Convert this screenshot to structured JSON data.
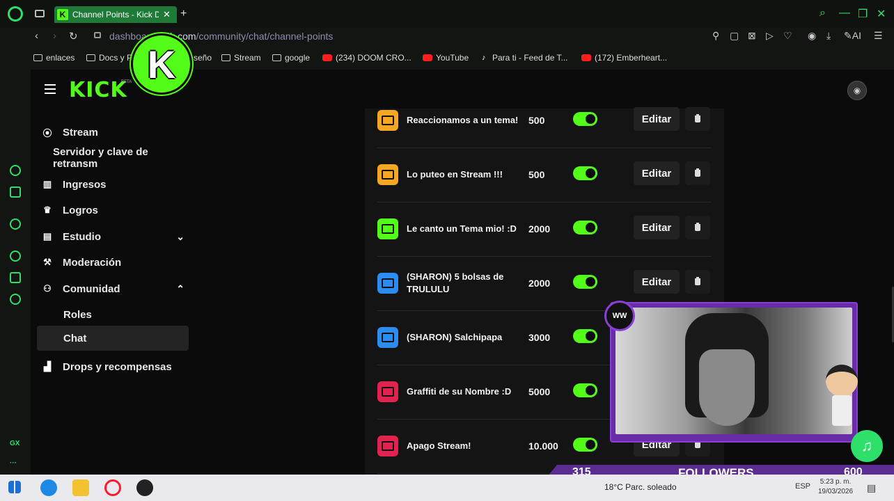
{
  "browser": {
    "tab_title": "Channel Points - Kick Dash",
    "tab_close": "✕",
    "new_tab": "+",
    "url_prefix": "dashboard.",
    "url_domain": "kick.com",
    "url_path": "/community/chat/channel-points",
    "bookmarks": [
      {
        "label": "enlaces",
        "icon": "folder-icon"
      },
      {
        "label": "Docs y P",
        "icon": "folder-icon"
      },
      {
        "label": "seño",
        "icon": "folder-icon"
      },
      {
        "label": "Stream",
        "icon": "folder-icon"
      },
      {
        "label": "google",
        "icon": "folder-icon"
      },
      {
        "label": "(234) DOOM CRO...",
        "icon": "youtube-icon"
      },
      {
        "label": "YouTube",
        "icon": "youtube-icon"
      },
      {
        "label": "Para ti - Feed de T...",
        "icon": "tiktok-icon"
      },
      {
        "label": "(172) Emberheart...",
        "icon": "youtube-icon"
      }
    ],
    "ai_label": "AI",
    "gx_label": "GX"
  },
  "overlay_logo": "K",
  "app": {
    "logo": "KICK",
    "beta": "BETA"
  },
  "sidebar": {
    "items": [
      {
        "label": "Stream",
        "icon": "broadcast-icon"
      },
      {
        "label": "Servidor y clave de retransm"
      },
      {
        "label": "Ingresos",
        "icon": "chart-icon"
      },
      {
        "label": "Logros",
        "icon": "trophy-icon"
      },
      {
        "label": "Estudio",
        "icon": "studio-icon",
        "chevron": "⌄"
      },
      {
        "label": "Moderación",
        "icon": "wrench-icon"
      },
      {
        "label": "Comunidad",
        "icon": "community-icon",
        "chevron": "⌃"
      },
      {
        "label": "Roles"
      },
      {
        "label": "Chat",
        "active": true
      },
      {
        "label": "Drops y recompensas",
        "icon": "drops-icon"
      }
    ]
  },
  "rewards": {
    "edit_label": "Editar",
    "rows": [
      {
        "title": "Reaccionamos a un tema!",
        "cost": "500",
        "color": "#f5a623",
        "enabled": true
      },
      {
        "title": "Lo puteo en Stream !!!",
        "cost": "500",
        "color": "#f5a623",
        "enabled": true
      },
      {
        "title": "Le canto un Tema mio! :D",
        "cost": "2000",
        "color": "#53fc18",
        "enabled": true
      },
      {
        "title": "(SHARON) 5 bolsas de TRULULU",
        "cost": "2000",
        "color": "#2d8cf0",
        "enabled": true
      },
      {
        "title": "(SHARON) Salchipapa",
        "cost": "3000",
        "color": "#2d8cf0",
        "enabled": true
      },
      {
        "title": "Graffiti de su Nombre :D",
        "cost": "5000",
        "color": "#e0244f",
        "enabled": true
      },
      {
        "title": "Apago Stream!",
        "cost": "10.000",
        "color": "#e0244f",
        "enabled": true
      }
    ]
  },
  "overlay": {
    "badge": "WW",
    "followers_count": "315",
    "followers_label": "FOLLOWERS",
    "followers_goal": "600",
    "progress_fraction": 0.525
  },
  "taskbar": {
    "weather": "18°C  Parc. soleado",
    "lang": "ESP",
    "time": "5:23 p. m.",
    "date": "19/03/2026"
  },
  "colors": {
    "kick_green": "#53fc18",
    "opera_green": "#2ee06a",
    "overlay_purple": "#5c2d91"
  }
}
